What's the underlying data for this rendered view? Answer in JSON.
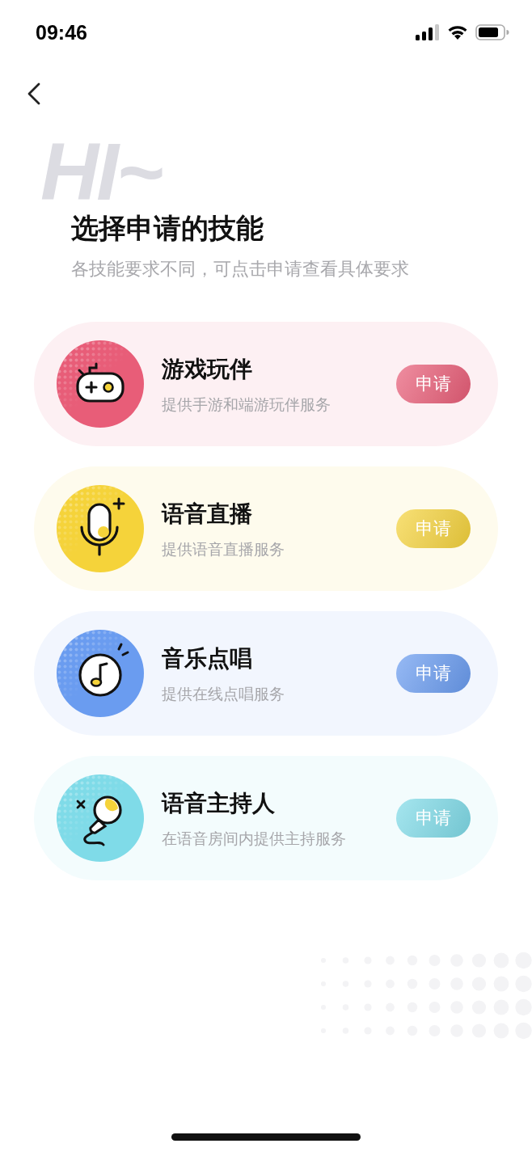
{
  "status_bar": {
    "time": "09:46"
  },
  "header": {
    "decor_text": "HI~",
    "title": "选择申请的技能",
    "subtitle": "各技能要求不同，可点击申请查看具体要求"
  },
  "skills": [
    {
      "kind": "game",
      "color": "#e85d78",
      "title": "游戏玩伴",
      "description": "提供手游和端游玩伴服务",
      "button": "申请"
    },
    {
      "kind": "mic",
      "color": "#f5d33a",
      "title": "语音直播",
      "description": "提供语音直播服务",
      "button": "申请"
    },
    {
      "kind": "music",
      "color": "#6a9cf0",
      "title": "音乐点唱",
      "description": "提供在线点唱服务",
      "button": "申请"
    },
    {
      "kind": "host",
      "color": "#7fdbe8",
      "title": "语音主持人",
      "description": "在语音房间内提供主持服务",
      "button": "申请"
    }
  ]
}
